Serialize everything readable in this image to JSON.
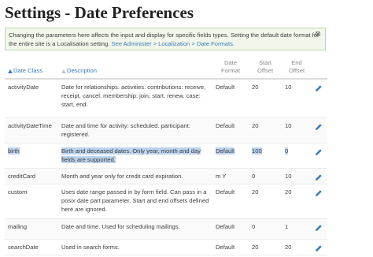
{
  "page": {
    "title": "Settings - Date Preferences"
  },
  "help": {
    "text": "Changing the parameters here affects the input and display for specific fields types. Setting the default date format for the entire site is a Localisation setting.",
    "link_text": "See Administer > Localization > Date Formats.",
    "close_label": "⊗"
  },
  "table": {
    "columns": {
      "date_class": "Date Class",
      "description": "Description",
      "date_format": "Date Format",
      "start_offset": "Start Offset",
      "end_offset": "End Offset"
    },
    "rows": [
      {
        "date_class": "activityDate",
        "description": "Date for relationships. activities. contributions: receive, receipt, cancel. membership: join, start, renew. case: start, end.",
        "date_format": "Default",
        "start_offset": "20",
        "end_offset": "10"
      },
      {
        "date_class": "activityDateTime",
        "description": "Date and time for activity: scheduled. participant: registered.",
        "date_format": "Default",
        "start_offset": "20",
        "end_offset": "10"
      },
      {
        "date_class": "birth",
        "description": "Birth and deceased dates. Only year, month and day fields are supported.",
        "date_format": "Default",
        "start_offset": "100",
        "end_offset": "0"
      },
      {
        "date_class": "creditCard",
        "description": "Month and year only for credit card expiration.",
        "date_format": "m Y",
        "start_offset": "0",
        "end_offset": "10"
      },
      {
        "date_class": "custom",
        "description": "Uses date range passed in by form field. Can pass in a posix date part parameter. Start and end offsets defined here are ignored.",
        "date_format": "Default",
        "start_offset": "20",
        "end_offset": "20"
      },
      {
        "date_class": "mailing",
        "description": "Date and time. Used for scheduling mailings.",
        "date_format": "Default",
        "start_offset": "0",
        "end_offset": "1"
      },
      {
        "date_class": "searchDate",
        "description": "Used in search forms.",
        "date_format": "Default",
        "start_offset": "20",
        "end_offset": "20"
      }
    ]
  },
  "colors": {
    "link": "#3b7bbd",
    "help_background": "#f1f8eb",
    "help_border": "#b9d8a6",
    "selection_highlight": "#bcd4ee"
  },
  "icons": {
    "sort_indicator": "sort-up-triangle-icon",
    "edit": "pencil-icon",
    "close": "close-circle-icon"
  }
}
